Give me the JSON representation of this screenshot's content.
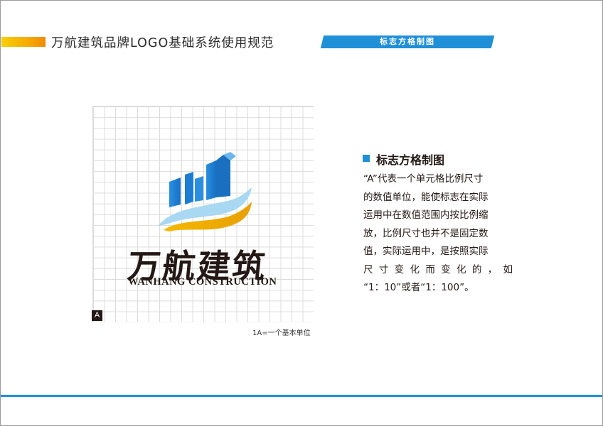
{
  "header": {
    "title": "万航建筑品牌LOGO基础系统使用规范",
    "tab_label": "标志方格制图"
  },
  "logo": {
    "name_cn": "万航建筑",
    "name_en": "WANHANG CONSTRUCTION"
  },
  "grid": {
    "unit_marker": "A",
    "caption": "1A=一个基本单位"
  },
  "section": {
    "heading": "标志方格制图",
    "lines": [
      "“A”代表一个单元格比例尺寸",
      "的数值单位，能使标志在实际",
      "运用中在数值范围内按比例缩",
      "放，比例尺寸也并不是固定数",
      "值，实际运用中，是按照实际",
      "尺寸变化而变化的，如",
      "“1：10”或者“1：100”。"
    ]
  },
  "colors": {
    "accent_blue": "#1f8fd8",
    "accent_orange": "#f5a400",
    "text_dark": "#231815",
    "grid_line": "#dcdcdc"
  }
}
